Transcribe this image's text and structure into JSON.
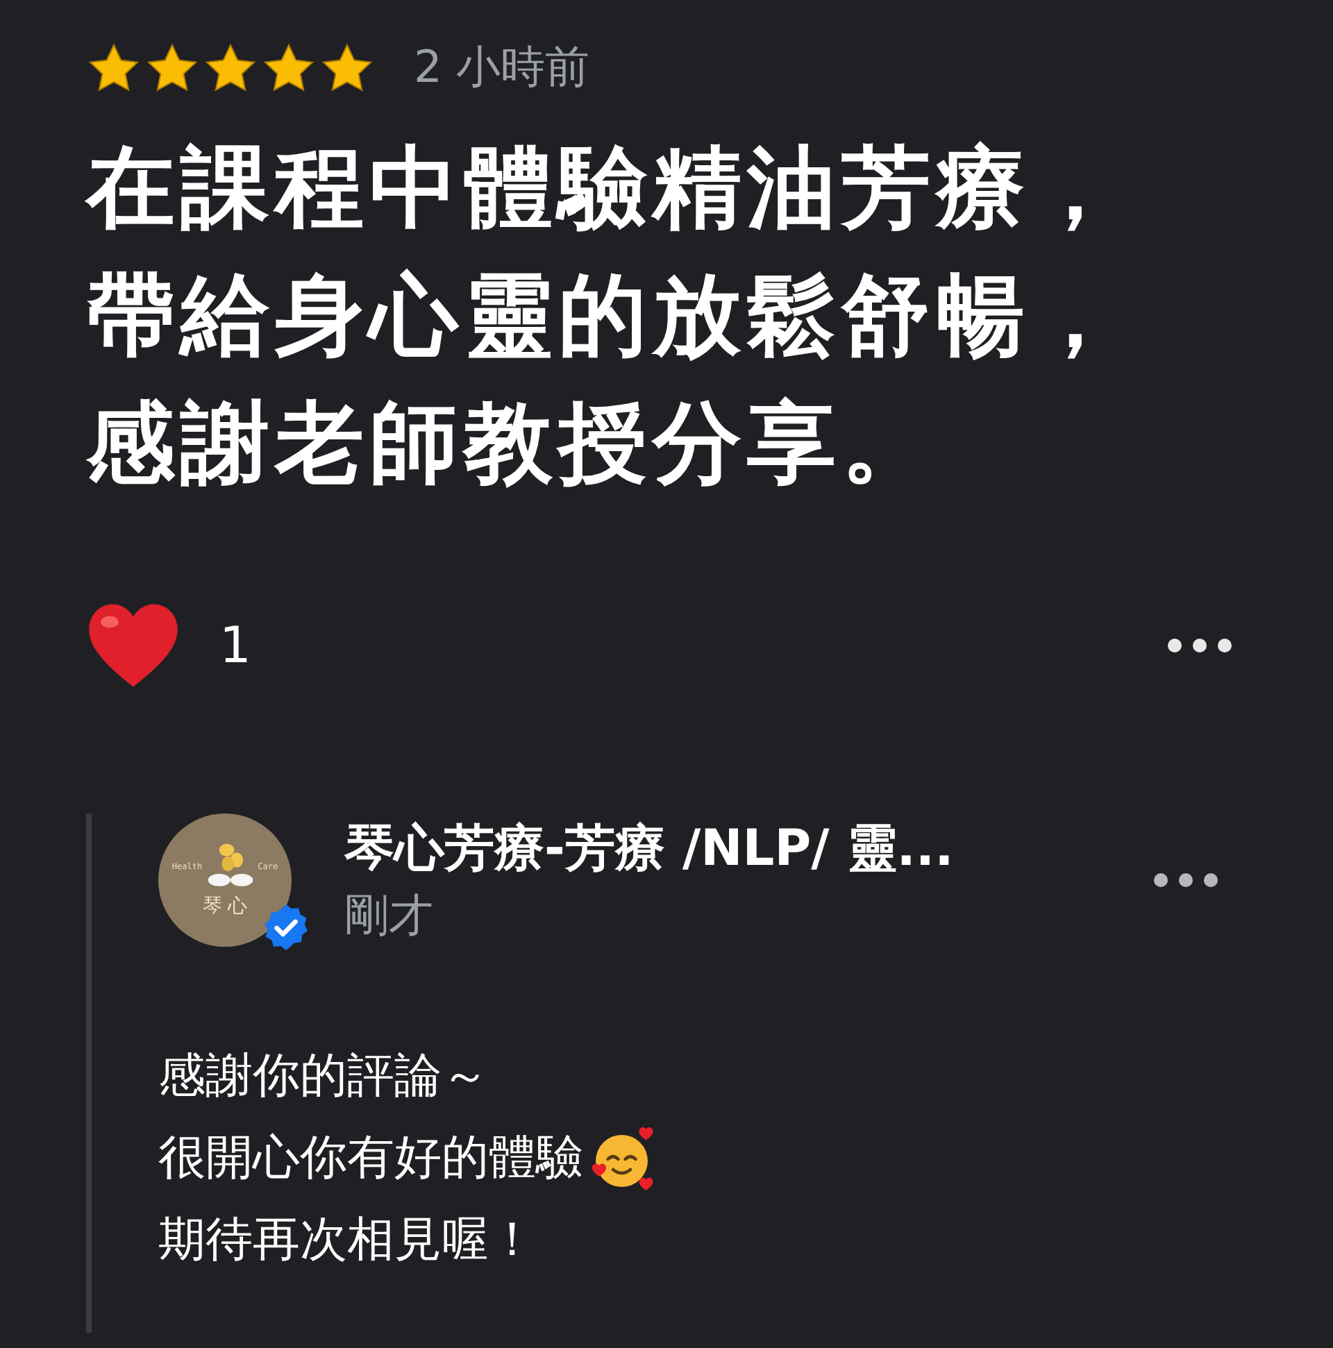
{
  "review": {
    "stars": 5,
    "time": "2 小時前",
    "text_lines": [
      "在課程中體驗精油芳療，",
      "帶給身心靈的放鬆舒暢，",
      "感謝老師教授分享。"
    ],
    "reaction_count": "1"
  },
  "reply": {
    "avatar": {
      "left_text": "Health",
      "right_text": "Care",
      "name_text": "琴 心",
      "verified": true
    },
    "author": "琴心芳療-芳療 /NLP/ 靈...",
    "time": "剛才",
    "lines": [
      {
        "text": "感謝你的評論～",
        "emoji": false
      },
      {
        "text": "很開心你有好的體驗",
        "emoji": true
      },
      {
        "text": "期待再次相見喔！",
        "emoji": false
      }
    ]
  }
}
